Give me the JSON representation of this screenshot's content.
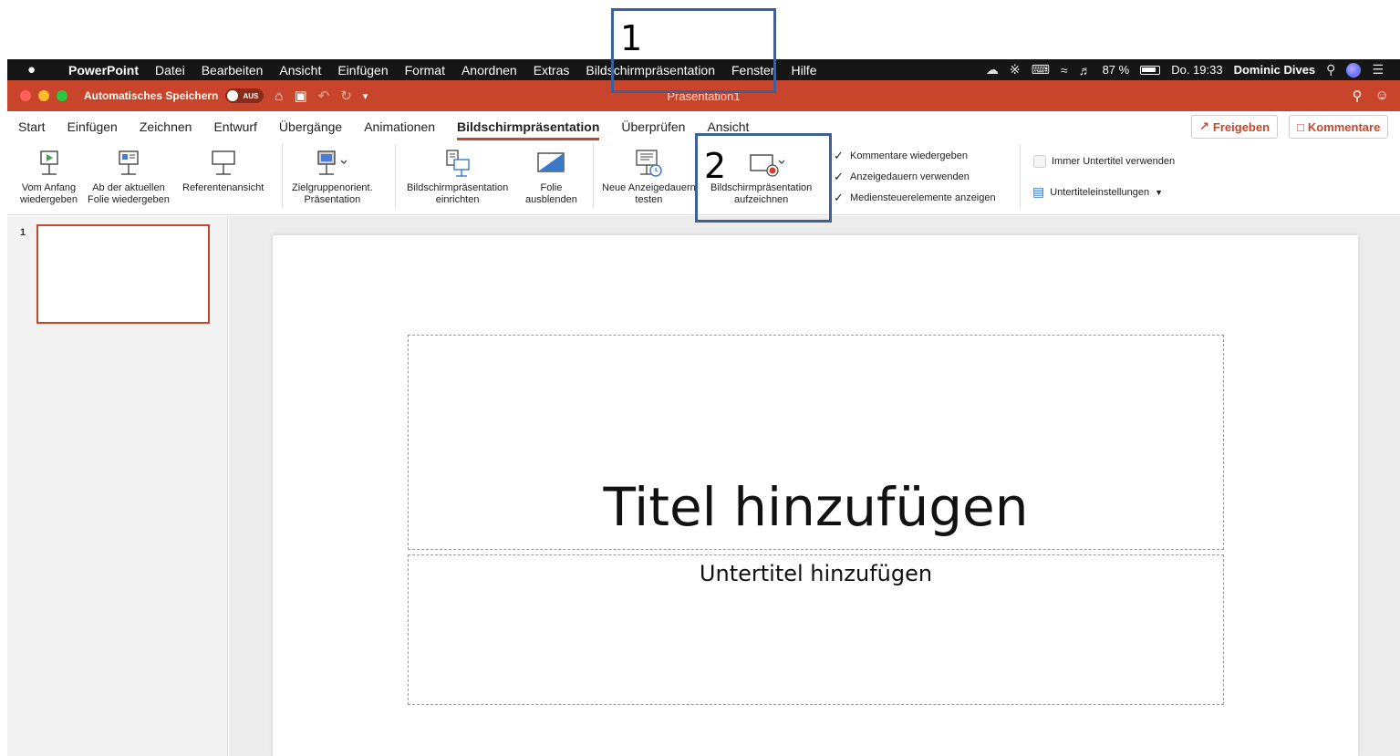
{
  "menubar": {
    "apple": "",
    "items": [
      "PowerPoint",
      "Datei",
      "Bearbeiten",
      "Ansicht",
      "Einfügen",
      "Format",
      "Anordnen",
      "Extras",
      "Bildschirmpräsentation",
      "Fenster",
      "Hilfe"
    ],
    "battery": "87 %",
    "clock": "Do. 19:33",
    "user": "Dominic Dives"
  },
  "titlebar": {
    "autosave": "Automatisches Speichern",
    "toggle": "AUS",
    "doc_title": "Präsentation1"
  },
  "tabs": [
    "Start",
    "Einfügen",
    "Zeichnen",
    "Entwurf",
    "Übergänge",
    "Animationen",
    "Bildschirmpräsentation",
    "Überprüfen",
    "Ansicht"
  ],
  "active_tab": "Bildschirmpräsentation",
  "share_label": "Freigeben",
  "comments_label": "Kommentare",
  "ribbon": {
    "from_start": [
      "Vom Anfang",
      "wiedergeben"
    ],
    "from_current": [
      "Ab der aktuellen",
      "Folie wiedergeben"
    ],
    "presenter": [
      "Referentenansicht"
    ],
    "custom": [
      "Zielgruppenorient.",
      "Präsentation"
    ],
    "setup": [
      "Bildschirmpräsentation",
      "einrichten"
    ],
    "hide": [
      "Folie",
      "ausblenden"
    ],
    "rehearse": [
      "Neue Anzeigedauern",
      "testen"
    ],
    "record": [
      "Bildschirmpräsentation",
      "aufzeichnen"
    ],
    "checks": [
      "Kommentare wiedergeben",
      "Anzeigedauern verwenden",
      "Mediensteuerelemente anzeigen"
    ],
    "subtitles_always": "Immer Untertitel verwenden",
    "subtitle_settings": "Untertiteleinstellungen"
  },
  "slides": [
    {
      "number": "1"
    }
  ],
  "slide": {
    "title": "Titel hinzufügen",
    "subtitle": "Untertitel hinzufügen"
  },
  "annotations": {
    "first": "1",
    "second": "2",
    "color": "#3e5f98"
  },
  "colors": {
    "accent": "#c8452b",
    "menubar": "#161616"
  }
}
